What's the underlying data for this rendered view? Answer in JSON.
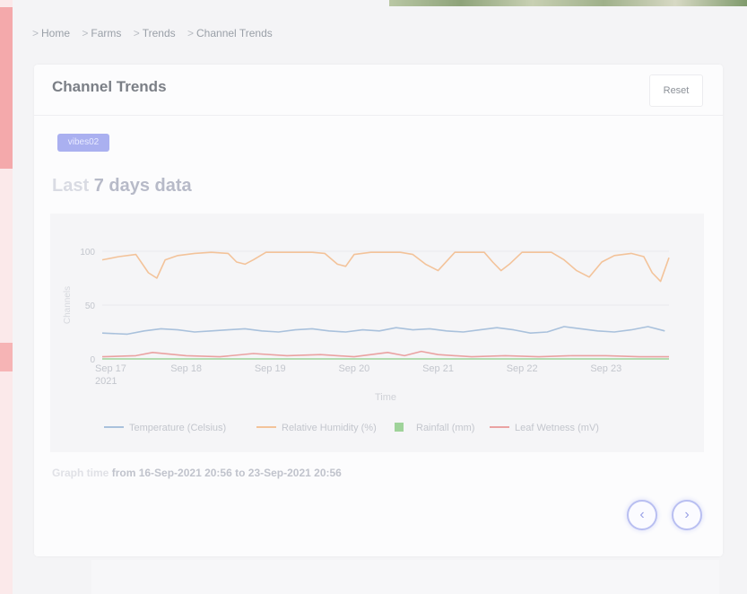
{
  "breadcrumb": [
    "Home",
    "Farms",
    "Trends",
    "Channel Trends"
  ],
  "breadcrumb_separator": ">",
  "card": {
    "title": "Channel Trends",
    "reset_label": "Reset",
    "device_badge": "vibes02",
    "period_prefix": "Last",
    "period_emph": "7 days data",
    "graph_time_prefix": "Graph time",
    "graph_time_text": "from 16-Sep-2021 20:56 to 23-Sep-2021 20:56",
    "prev_icon": "chevron-left-icon",
    "next_icon": "chevron-right-icon"
  },
  "colors": {
    "temperature": "#a9c1dc",
    "humidity": "#f3c39a",
    "rainfall": "#9fd39a",
    "leaf_wetness": "#eaa2a2",
    "accent": "#aab0f0"
  },
  "chart_data": {
    "type": "line",
    "xlabel": "Time",
    "ylabel": "Channels",
    "ylim": [
      0,
      100
    ],
    "yticks": [
      "0",
      "50",
      "100"
    ],
    "xticks": [
      {
        "pos": 17,
        "label": "Sep 17",
        "sub": "2021"
      },
      {
        "pos": 18,
        "label": "Sep 18"
      },
      {
        "pos": 19,
        "label": "Sep 19"
      },
      {
        "pos": 20,
        "label": "Sep 20"
      },
      {
        "pos": 21,
        "label": "Sep 21"
      },
      {
        "pos": 22,
        "label": "Sep 22"
      },
      {
        "pos": 23,
        "label": "Sep 23"
      }
    ],
    "xlim": [
      17,
      23.75
    ],
    "legend": [
      {
        "name": "Temperature (Celsius)",
        "key": "temperature",
        "marker": "line"
      },
      {
        "name": "Relative Humidity (%)",
        "key": "humidity",
        "marker": "line"
      },
      {
        "name": "Rainfall (mm)",
        "key": "rainfall",
        "marker": "square"
      },
      {
        "name": "Leaf Wetness (mV)",
        "key": "leaf_wetness",
        "marker": "line"
      }
    ],
    "series": [
      {
        "name": "Temperature (Celsius)",
        "key": "temperature",
        "x": [
          17.0,
          17.3,
          17.5,
          17.7,
          17.9,
          18.1,
          18.3,
          18.5,
          18.7,
          18.9,
          19.1,
          19.3,
          19.5,
          19.7,
          19.9,
          20.1,
          20.3,
          20.5,
          20.7,
          20.9,
          21.1,
          21.3,
          21.5,
          21.7,
          21.9,
          22.1,
          22.3,
          22.5,
          22.7,
          22.9,
          23.1,
          23.3,
          23.5,
          23.7
        ],
        "y": [
          24,
          23,
          26,
          28,
          27,
          25,
          26,
          27,
          28,
          26,
          25,
          27,
          28,
          26,
          25,
          27,
          26,
          29,
          27,
          28,
          26,
          25,
          27,
          29,
          27,
          24,
          25,
          30,
          28,
          26,
          25,
          27,
          30,
          26
        ]
      },
      {
        "name": "Relative Humidity (%)",
        "key": "humidity",
        "x": [
          17.0,
          17.2,
          17.4,
          17.55,
          17.65,
          17.75,
          17.9,
          18.1,
          18.3,
          18.5,
          18.6,
          18.7,
          18.8,
          18.95,
          19.1,
          19.3,
          19.5,
          19.65,
          19.8,
          19.9,
          20.0,
          20.2,
          20.4,
          20.55,
          20.7,
          20.85,
          21.0,
          21.2,
          21.4,
          21.55,
          21.65,
          21.75,
          21.85,
          22.0,
          22.2,
          22.35,
          22.5,
          22.65,
          22.8,
          22.95,
          23.1,
          23.3,
          23.45,
          23.55,
          23.65,
          23.75
        ],
        "y": [
          92,
          95,
          97,
          80,
          75,
          92,
          96,
          98,
          99,
          98,
          90,
          88,
          92,
          99,
          99,
          99,
          99,
          98,
          88,
          86,
          97,
          99,
          99,
          99,
          97,
          88,
          82,
          99,
          99,
          99,
          90,
          82,
          88,
          99,
          99,
          99,
          92,
          82,
          76,
          90,
          96,
          98,
          95,
          80,
          72,
          94
        ]
      },
      {
        "name": "Rainfall (mm)",
        "key": "rainfall",
        "x": [
          17.0,
          23.75
        ],
        "y": [
          0,
          0
        ]
      },
      {
        "name": "Leaf Wetness (mV)",
        "key": "leaf_wetness",
        "x": [
          17.0,
          17.4,
          17.6,
          18.0,
          18.4,
          18.8,
          19.2,
          19.6,
          20.0,
          20.4,
          20.6,
          20.8,
          21.0,
          21.4,
          21.8,
          22.2,
          22.6,
          23.0,
          23.4,
          23.75
        ],
        "y": [
          2,
          3,
          6,
          3,
          2,
          5,
          3,
          4,
          2,
          6,
          3,
          7,
          4,
          2,
          3,
          2,
          3,
          3,
          2,
          2
        ]
      }
    ]
  }
}
